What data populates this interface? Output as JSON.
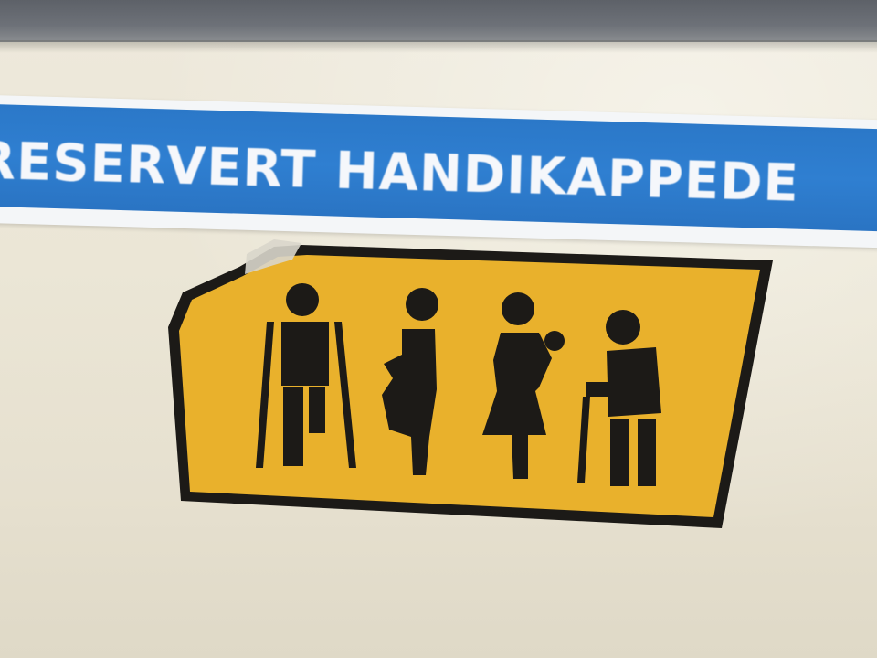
{
  "scene": {
    "wall_color": "#ebe6d6",
    "trim_color": "#666a70"
  },
  "label": {
    "text": "RESERVERT HANDIKAPPEDE",
    "band_color": "#2f7fd1",
    "text_color": "#f5f7fb"
  },
  "sticker": {
    "background_color": "#e9b12c",
    "border_color": "#1c1a17",
    "pictograms": [
      {
        "name": "person-with-crutches-icon"
      },
      {
        "name": "pregnant-woman-icon"
      },
      {
        "name": "person-with-child-icon"
      },
      {
        "name": "elderly-person-with-cane-icon"
      }
    ]
  }
}
